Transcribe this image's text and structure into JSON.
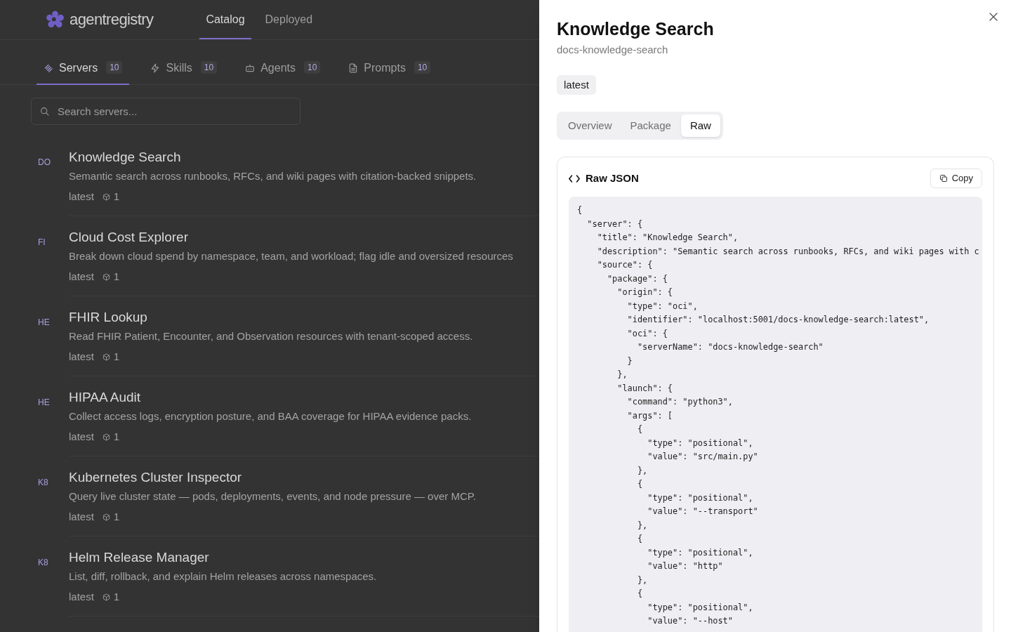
{
  "app": {
    "logo": "agentregistry",
    "nav": [
      {
        "label": "Catalog",
        "selected": true
      },
      {
        "label": "Deployed",
        "selected": false
      }
    ]
  },
  "catalog_tabs": [
    {
      "label": "Servers",
      "count": "10",
      "selected": true
    },
    {
      "label": "Skills",
      "count": "10",
      "selected": false
    },
    {
      "label": "Agents",
      "count": "10",
      "selected": false
    },
    {
      "label": "Prompts",
      "count": "10",
      "selected": false
    }
  ],
  "search": {
    "placeholder": "Search servers..."
  },
  "servers": [
    {
      "initials": "DO",
      "title": "Knowledge Search",
      "description": "Semantic search across runbooks, RFCs, and wiki pages with citation-backed snippets.",
      "version": "latest",
      "package_count": "1"
    },
    {
      "initials": "FI",
      "title": "Cloud Cost Explorer",
      "description": "Break down cloud spend by namespace, team, and workload; flag idle and oversized resources",
      "version": "latest",
      "package_count": "1"
    },
    {
      "initials": "HE",
      "title": "FHIR Lookup",
      "description": "Read FHIR Patient, Encounter, and Observation resources with tenant-scoped access.",
      "version": "latest",
      "package_count": "1"
    },
    {
      "initials": "HE",
      "title": "HIPAA Audit",
      "description": "Collect access logs, encryption posture, and BAA coverage for HIPAA evidence packs.",
      "version": "latest",
      "package_count": "1"
    },
    {
      "initials": "K8",
      "title": "Kubernetes Cluster Inspector",
      "description": "Query live cluster state — pods, deployments, events, and node pressure — over MCP.",
      "version": "latest",
      "package_count": "1"
    },
    {
      "initials": "K8",
      "title": "Helm Release Manager",
      "description": "List, diff, rollback, and explain Helm releases across namespaces.",
      "version": "latest",
      "package_count": "1"
    }
  ],
  "drawer": {
    "title": "Knowledge Search",
    "name": "docs-knowledge-search",
    "version_badge": "latest",
    "tabs": [
      {
        "label": "Overview",
        "selected": false
      },
      {
        "label": "Package",
        "selected": false
      },
      {
        "label": "Raw",
        "selected": true
      }
    ],
    "raw_card": {
      "title": "Raw JSON",
      "copy_button": "Copy",
      "code_lines": [
        "{",
        "  \"server\": {",
        "    \"title\": \"Knowledge Search\",",
        "    \"description\": \"Semantic search across runbooks, RFCs, and wiki pages with c",
        "    \"source\": {",
        "      \"package\": {",
        "        \"origin\": {",
        "          \"type\": \"oci\",",
        "          \"identifier\": \"localhost:5001/docs-knowledge-search:latest\",",
        "          \"oci\": {",
        "            \"serverName\": \"docs-knowledge-search\"",
        "          }",
        "        },",
        "        \"launch\": {",
        "          \"command\": \"python3\",",
        "          \"args\": [",
        "            {",
        "              \"type\": \"positional\",",
        "              \"value\": \"src/main.py\"",
        "            },",
        "            {",
        "              \"type\": \"positional\",",
        "              \"value\": \"--transport\"",
        "            },",
        "            {",
        "              \"type\": \"positional\",",
        "              \"value\": \"http\"",
        "            },",
        "            {",
        "              \"type\": \"positional\",",
        "              \"value\": \"--host\""
      ]
    }
  }
}
